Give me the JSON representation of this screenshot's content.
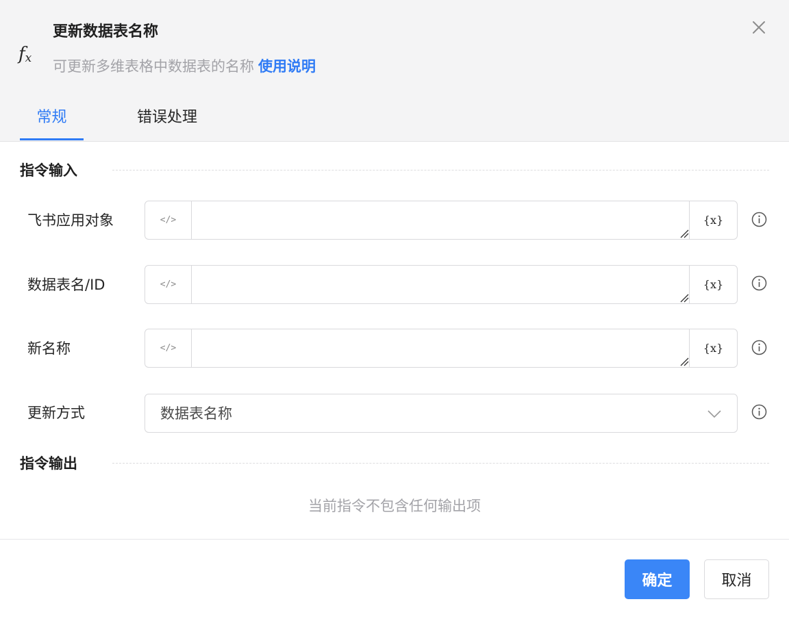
{
  "dialog": {
    "title": "更新数据表名称",
    "subtitle": "可更新多维表格中数据表的名称",
    "help_link": "使用说明",
    "icon": "fx-icon",
    "close_icon": "close-icon"
  },
  "tabs": [
    {
      "label": "常规",
      "active": true
    },
    {
      "label": "错误处理",
      "active": false
    }
  ],
  "sections": {
    "input_title": "指令输入",
    "output_title": "指令输出",
    "output_empty": "当前指令不包含任何输出项"
  },
  "fields": [
    {
      "label": "飞书应用对象",
      "value": "",
      "code_icon": "</>",
      "var_icon": "{x}"
    },
    {
      "label": "数据表名/ID",
      "value": "",
      "code_icon": "</>",
      "var_icon": "{x}"
    },
    {
      "label": "新名称",
      "value": "",
      "code_icon": "</>",
      "var_icon": "{x}"
    }
  ],
  "update_mode": {
    "label": "更新方式",
    "selected": "数据表名称"
  },
  "buttons": {
    "ok": "确定",
    "cancel": "取消"
  },
  "colors": {
    "accent": "#2f7bf5",
    "primary_button": "#3a86f7",
    "header_bg": "#f4f4f5"
  }
}
